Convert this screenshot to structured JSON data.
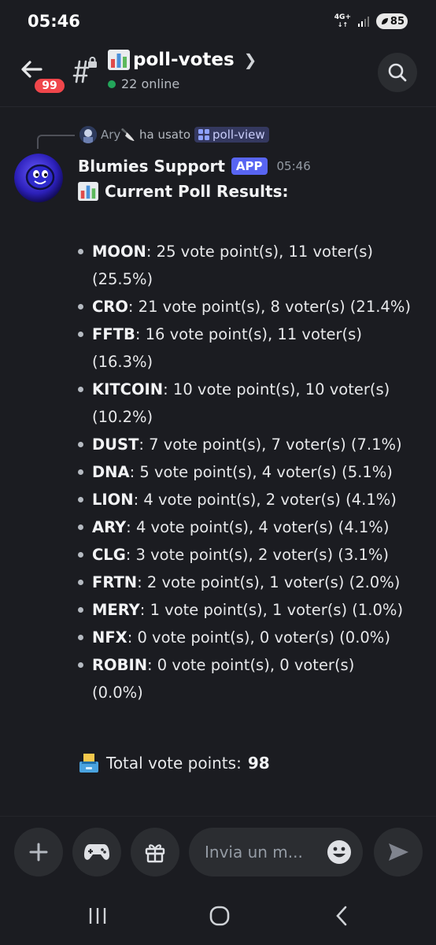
{
  "status": {
    "time": "05:46",
    "network": "4G+",
    "battery": "85"
  },
  "header": {
    "unread_badge": "99",
    "channel_name": "poll-votes",
    "online": "22 online"
  },
  "reply": {
    "user": "Ary🔪",
    "action": "ha usato",
    "command": "poll-view"
  },
  "message": {
    "author": "Blumies Support",
    "app_tag": "APP",
    "time": "05:46",
    "title": "Current Poll Results:",
    "items": [
      {
        "name": "MOON",
        "text": ": 25 vote point(s), 11 voter(s)",
        "pct": "(25.5%)"
      },
      {
        "name": "CRO",
        "text": ": 21 vote point(s), 8 voter(s) (21.4%)",
        "pct": ""
      },
      {
        "name": "FFTB",
        "text": ": 16 vote point(s), 11 voter(s)",
        "pct": "(16.3%)"
      },
      {
        "name": "KITCOIN",
        "text": ": 10 vote point(s), 10 voter(s)",
        "pct": "(10.2%)"
      },
      {
        "name": "DUST",
        "text": ": 7 vote point(s), 7 voter(s) (7.1%)",
        "pct": ""
      },
      {
        "name": "DNA",
        "text": ": 5 vote point(s), 4 voter(s) (5.1%)",
        "pct": ""
      },
      {
        "name": "LION",
        "text": ": 4 vote point(s), 2 voter(s) (4.1%)",
        "pct": ""
      },
      {
        "name": "ARY",
        "text": ": 4 vote point(s), 4 voter(s) (4.1%)",
        "pct": ""
      },
      {
        "name": "CLG",
        "text": ": 3 vote point(s), 2 voter(s) (3.1%)",
        "pct": ""
      },
      {
        "name": "FRTN",
        "text": ": 2 vote point(s), 1 voter(s) (2.0%)",
        "pct": ""
      },
      {
        "name": "MERY",
        "text": ": 1 vote point(s), 1 voter(s) (1.0%)",
        "pct": ""
      },
      {
        "name": "NFX",
        "text": ": 0 vote point(s), 0 voter(s) (0.0%)",
        "pct": ""
      },
      {
        "name": "ROBIN",
        "text": ": 0 vote point(s), 0 voter(s)",
        "pct": "(0.0%)"
      }
    ],
    "total_label": "Total vote points:",
    "total_value": "98"
  },
  "composer": {
    "placeholder": "Invia un m..."
  },
  "colors": {
    "background": "#1b1c21",
    "accent": "#5865f2",
    "badge": "#f0464b",
    "online": "#23a55a"
  },
  "icons": [
    "back-arrow-icon",
    "hash-lock-icon",
    "chevron-right-icon",
    "search-icon",
    "plus-icon",
    "gamepad-icon",
    "gift-icon",
    "emoji-icon",
    "send-icon",
    "recents-icon",
    "home-icon",
    "back-icon"
  ]
}
